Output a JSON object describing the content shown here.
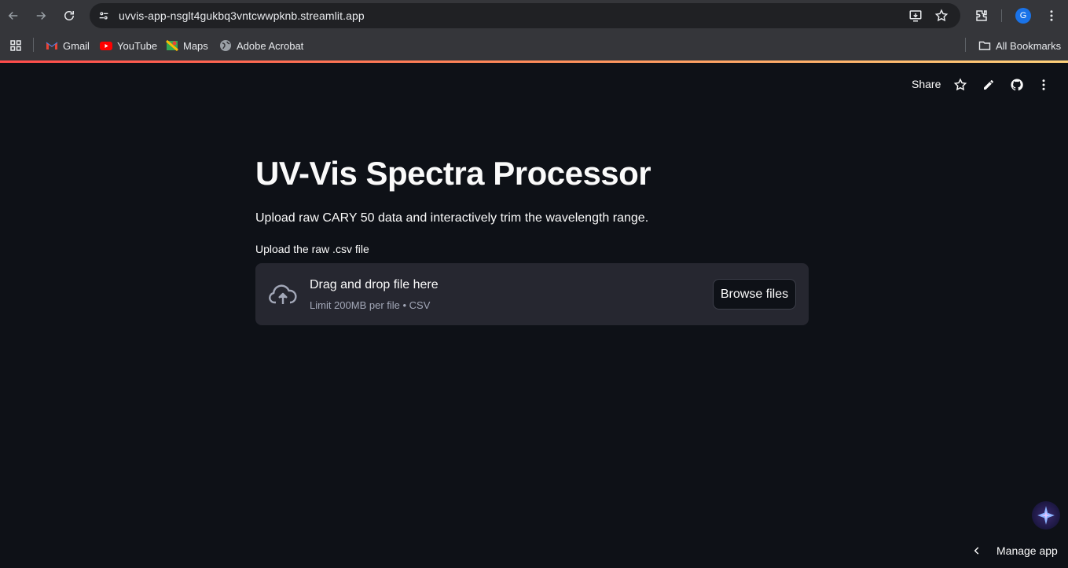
{
  "browser": {
    "url": "uvvis-app-nsglt4gukbq3vntcwwpknb.streamlit.app",
    "avatar_initial": "G",
    "bookmarks": [
      {
        "label": "Gmail",
        "icon": "gmail-icon"
      },
      {
        "label": "YouTube",
        "icon": "youtube-icon"
      },
      {
        "label": "Maps",
        "icon": "maps-icon"
      },
      {
        "label": "Adobe Acrobat",
        "icon": "globe-icon"
      }
    ],
    "all_bookmarks": "All Bookmarks"
  },
  "header": {
    "share_label": "Share"
  },
  "main": {
    "title": "UV-Vis Spectra Processor",
    "subtitle": "Upload raw CARY 50 data and interactively trim the wavelength range.",
    "uploader": {
      "label": "Upload the raw .csv file",
      "dropzone_title": "Drag and drop file here",
      "dropzone_hint": "Limit 200MB per file • CSV",
      "browse_label": "Browse files"
    }
  },
  "footer": {
    "manage_label": "Manage app"
  },
  "colors": {
    "background": "#0e1117",
    "dropzone": "#262730",
    "text": "#fafafa",
    "muted": "#a3a8b8",
    "accent": "#ff4b4b"
  }
}
